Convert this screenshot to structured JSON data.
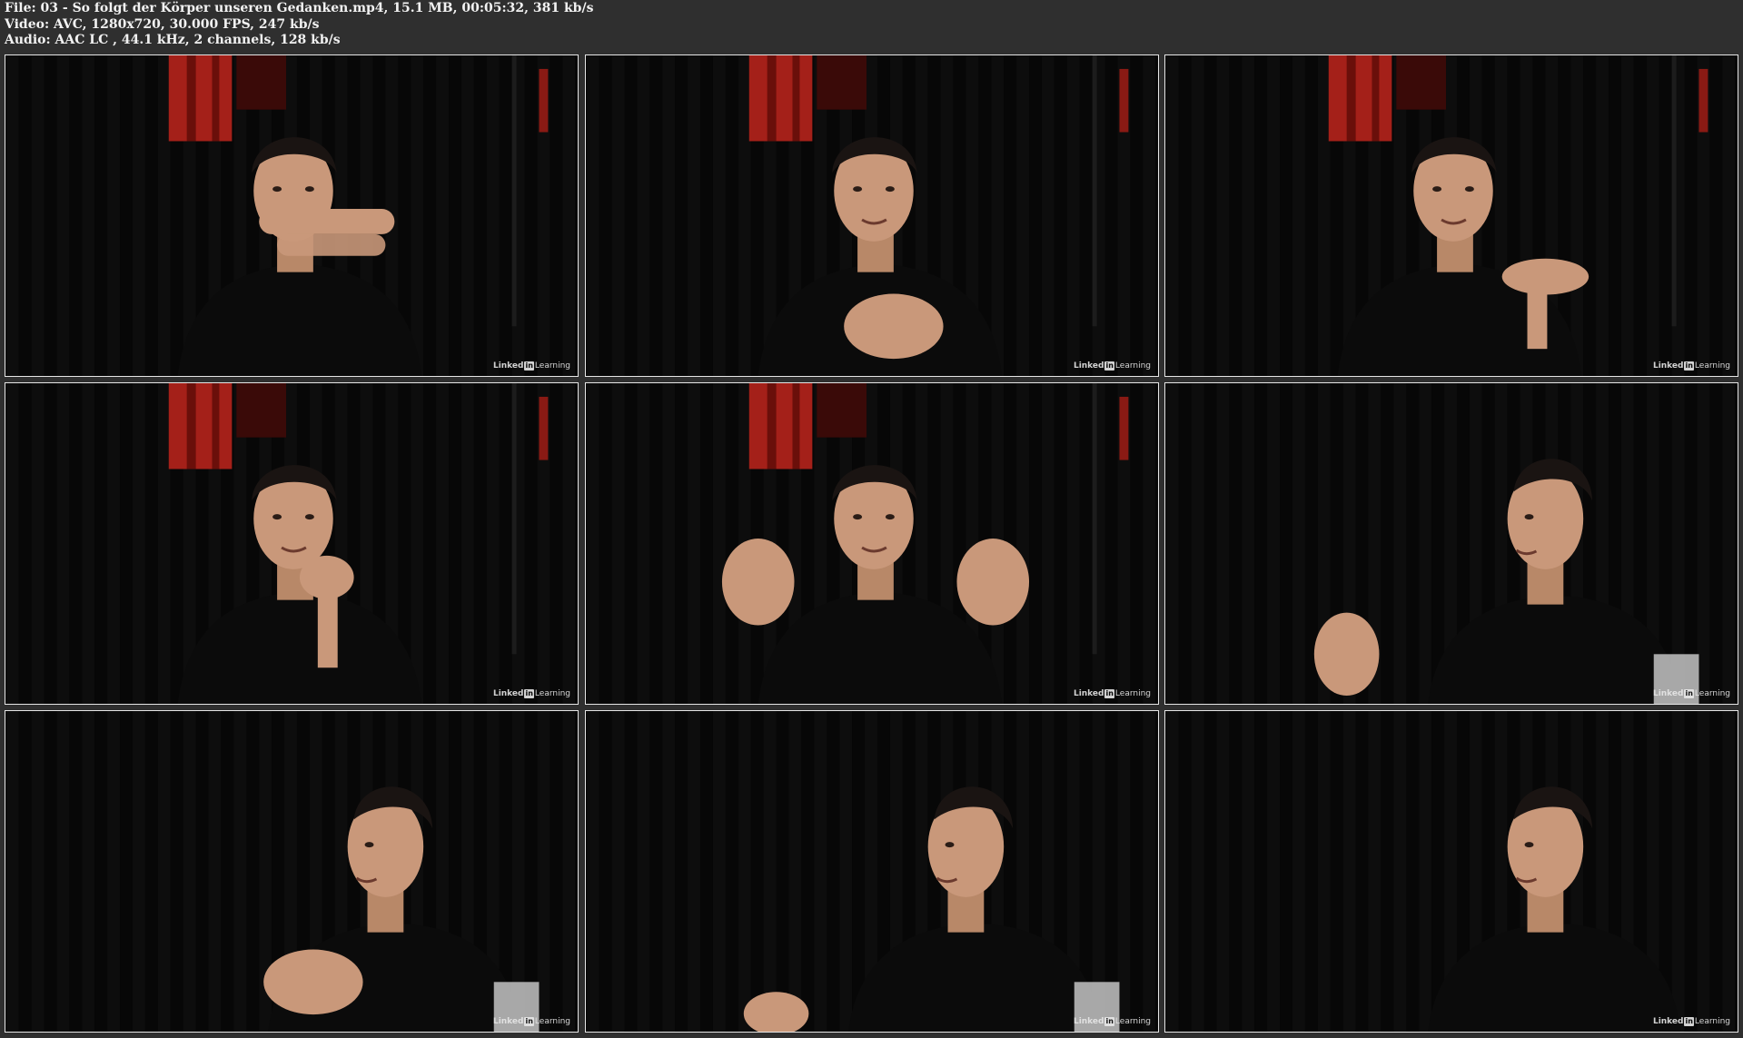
{
  "header": {
    "file_line": "File: 03 - So folgt der Körper unseren Gedanken.mp4, 15.1 MB, 00:05:32, 381 kb/s",
    "video_line": "Video: AVC, 1280x720, 30.000 FPS, 247 kb/s",
    "audio_line": "Audio: AAC LC , 44.1 kHz, 2 channels, 128 kb/s"
  },
  "watermark": {
    "a": "Linked",
    "in": "in",
    "b": "Learning"
  },
  "colors": {
    "background": "#2f2f2f",
    "frame_border": "#e6e6e6",
    "curtain": "#0a0a0a",
    "stage_light": "#c0241c"
  },
  "frames": [
    {
      "scene": "front",
      "gesture": "hands-crossed"
    },
    {
      "scene": "front",
      "gesture": "hands-clasped"
    },
    {
      "scene": "front",
      "gesture": "open-palm"
    },
    {
      "scene": "front",
      "gesture": "pinch"
    },
    {
      "scene": "front",
      "gesture": "both-hands-open"
    },
    {
      "scene": "side",
      "gesture": "open-hand"
    },
    {
      "scene": "side",
      "gesture": "hands-clasped"
    },
    {
      "scene": "side",
      "gesture": "hand-low"
    },
    {
      "scene": "side",
      "gesture": "none"
    }
  ]
}
